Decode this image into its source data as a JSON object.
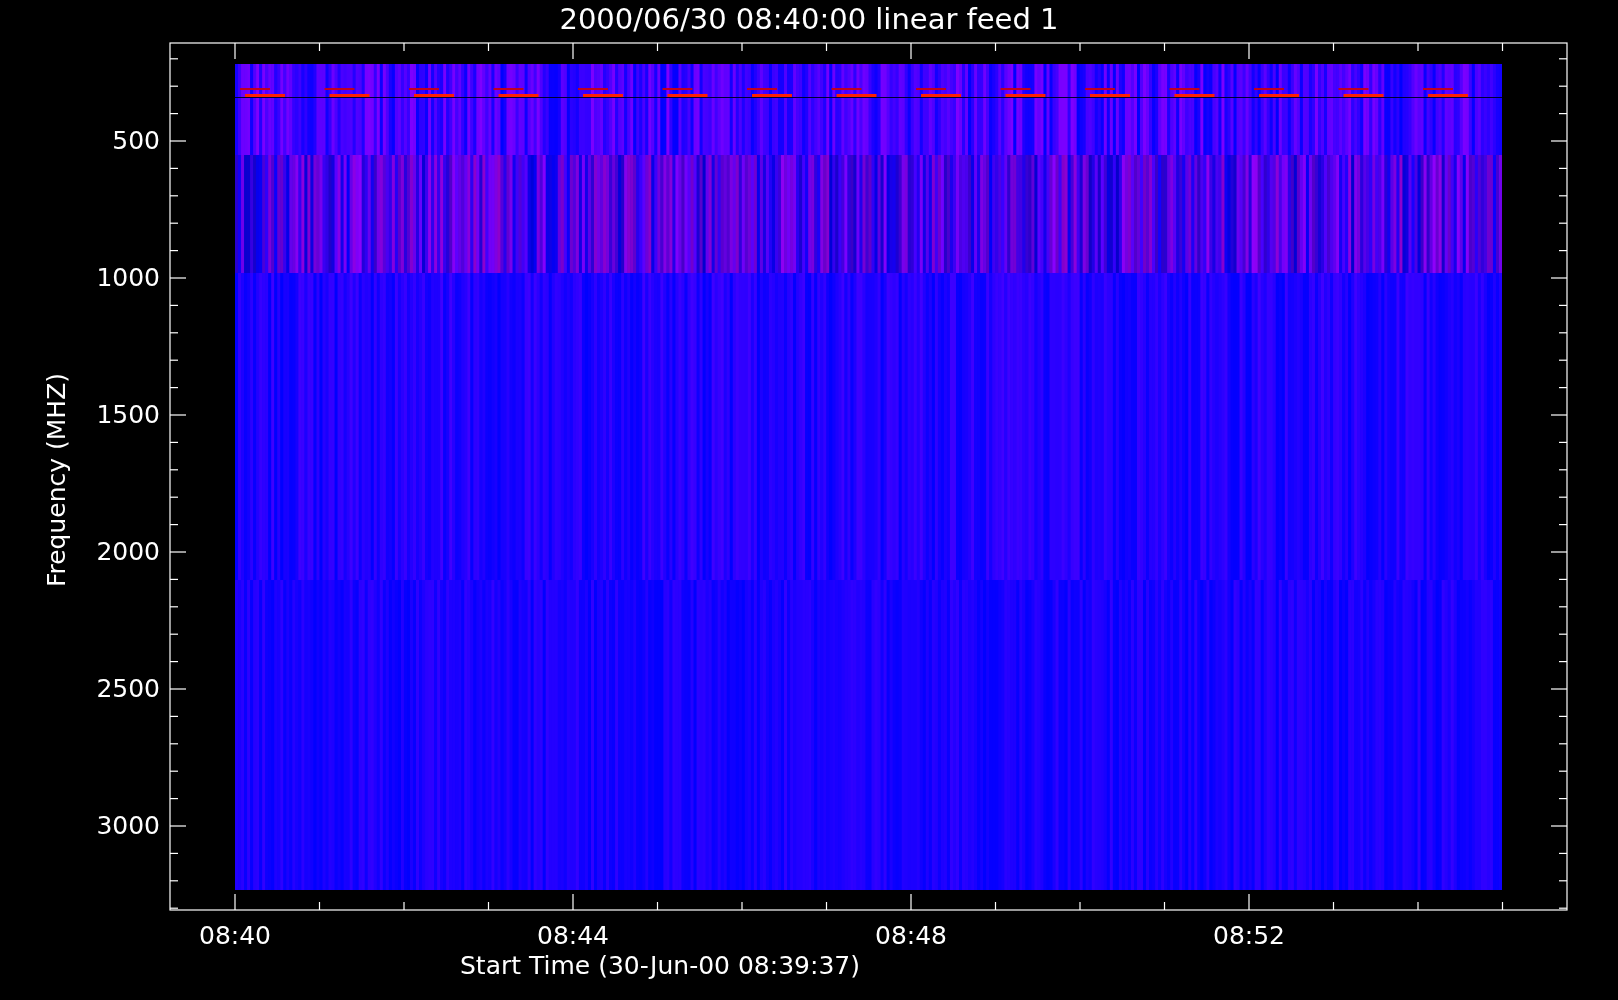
{
  "plot": {
    "title": "2000/06/30 08:40:00 linear feed 1",
    "y_axis": {
      "label": "Frequency (MHZ)",
      "ticks": [
        "500",
        "1000",
        "1500",
        "2000",
        "2500",
        "3000"
      ]
    },
    "x_axis": {
      "label": "Start Time (30-Jun-00 08:39:37)",
      "ticks": [
        "08:40",
        "08:44",
        "08:48",
        "08:52"
      ]
    }
  }
}
